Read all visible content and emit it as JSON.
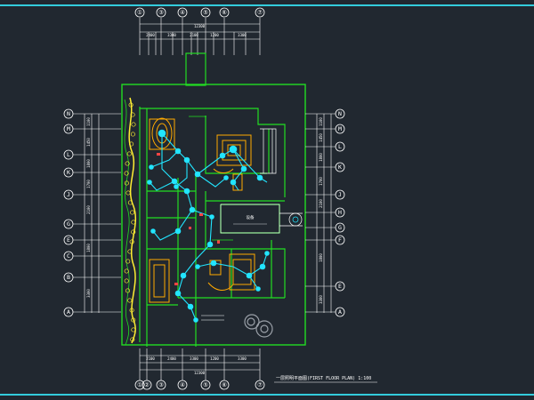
{
  "top_axes": [
    "①",
    "③",
    "④",
    "⑤",
    "⑥",
    "⑦"
  ],
  "bottom_axes": [
    "①",
    "②",
    "③",
    "④",
    "⑤",
    "⑥",
    "⑦"
  ],
  "left_axes": [
    "N",
    "M",
    "L",
    "K",
    "J",
    "G",
    "E",
    "C",
    "B",
    "A"
  ],
  "right_axes": [
    "N",
    "M",
    "L",
    "K",
    "J",
    "H",
    "G",
    "F",
    "E",
    "A"
  ],
  "top_dims": [
    "2400",
    "3300",
    "2100",
    "1200",
    "3300"
  ],
  "top_total": "12300",
  "bottom_dims": [
    "2100",
    "2400",
    "3300",
    "1200",
    "3300"
  ],
  "bottom_total": "12300",
  "left_dims": [
    "1100",
    "1450",
    "1800",
    "1700",
    "2100",
    "1800",
    "3300"
  ],
  "right_dims": [
    "1100",
    "1450",
    "1800",
    "1700",
    "2100",
    "1800",
    "3300"
  ],
  "room_label": "设备",
  "title": "一层照明平面图(FIRST FLOOR PLAN) 1:100",
  "colors": {
    "background": "#212830",
    "wall": "#22dd22",
    "fixture": "#22e5ff",
    "dimension": "#ffffff",
    "furniture": "#ffaa00",
    "landscape": "#ffee33",
    "accent": "#ff4444",
    "border": "#33ccdd"
  }
}
